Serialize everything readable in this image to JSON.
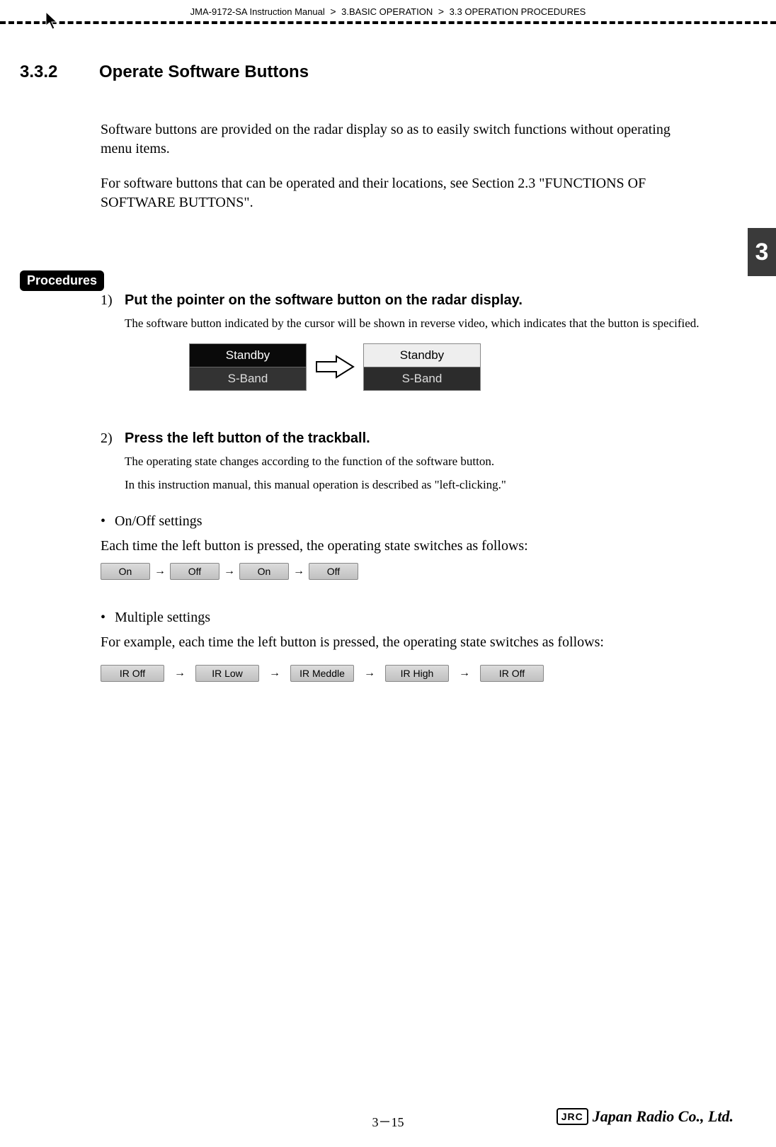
{
  "breadcrumb": {
    "a": "JMA-9172-SA Instruction Manual",
    "b": "3.BASIC OPERATION",
    "c": "3.3  OPERATION PROCEDURES",
    "sep": ">"
  },
  "chapter_tab": "3",
  "heading": {
    "num": "3.3.2",
    "title": "Operate Software Buttons"
  },
  "intro": {
    "p1": "Software buttons are provided on the radar display so as to easily switch functions without operating menu items.",
    "p2": "For software buttons that can be operated and their locations, see Section 2.3 \"FUNCTIONS OF SOFTWARE BUTTONS\"."
  },
  "procedures_label": "Procedures",
  "steps": {
    "s1": {
      "n": "1)",
      "title": "Put the pointer on the software button on the radar display.",
      "sub": "The software button indicated by the cursor will be shown in reverse video, which indicates that the button is specified.",
      "box_row1": "Standby",
      "box_row2": "S-Band"
    },
    "s2": {
      "n": "2)",
      "title": "Press the left button of the trackball.",
      "sub1": "The operating state changes according to the function of the software button.",
      "sub2": "In this instruction manual, this manual operation is described as \"left-clicking.\""
    }
  },
  "onoff": {
    "bullet": "On/Off settings",
    "desc": "Each time the left button is pressed, the operating state switches as follows:",
    "seq": [
      "On",
      "Off",
      "On",
      "Off"
    ],
    "arrow": "→"
  },
  "multi": {
    "bullet": "Multiple settings",
    "desc": "For example, each time the left button is pressed, the operating state switches as follows:",
    "seq": [
      "IR Off",
      "IR Low",
      "IR Meddle",
      "IR High",
      "IR Off"
    ],
    "arrow": "→"
  },
  "footer": {
    "page": "3－15",
    "jrc": "JRC",
    "company": "Japan Radio Co., Ltd."
  }
}
